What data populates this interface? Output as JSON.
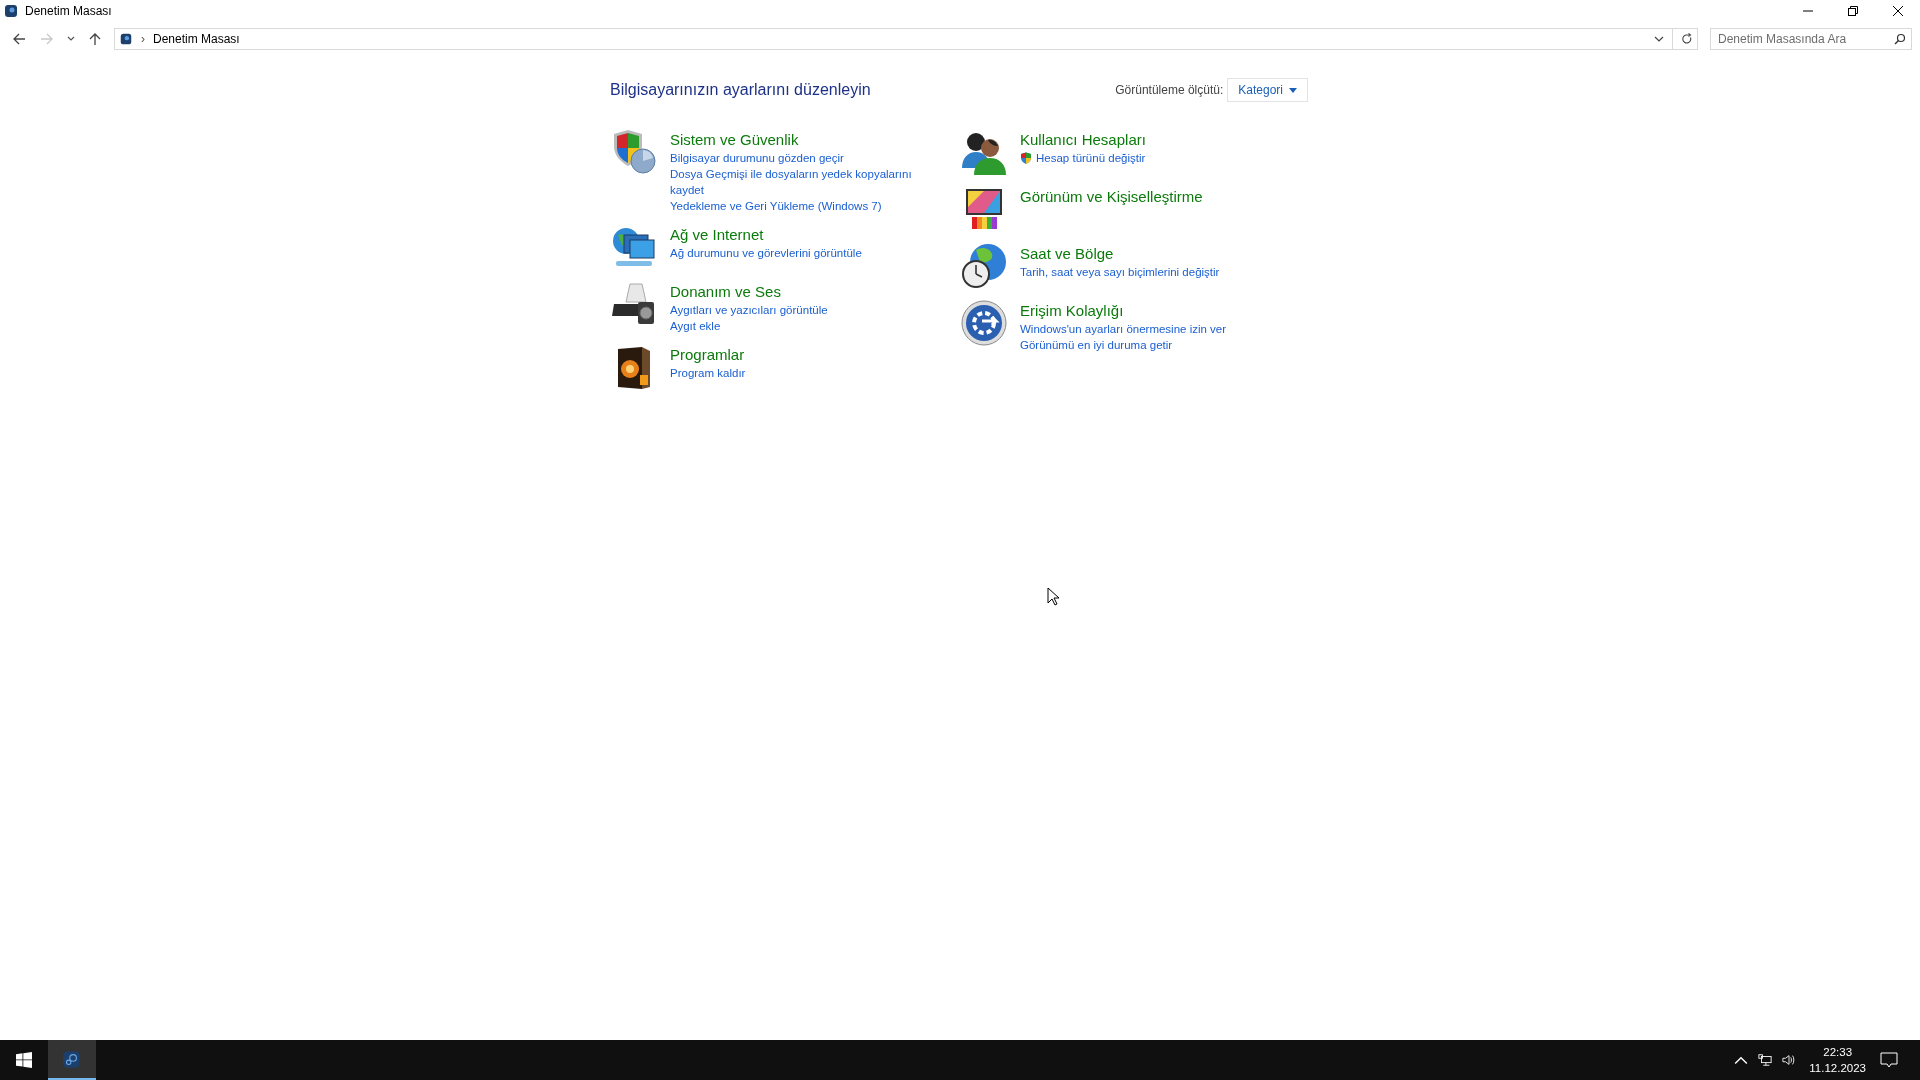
{
  "window": {
    "title": "Denetim Masası"
  },
  "address_bar": {
    "forward_disabled": true,
    "separator": "›",
    "path": "Denetim Masası"
  },
  "search": {
    "placeholder": "Denetim Masasında Ara"
  },
  "heading": "Bilgisayarınızın ayarlarını düzenleyin",
  "view_by": {
    "label": "Görüntüleme ölçütü:",
    "value": "Kategori"
  },
  "columns": [
    {
      "categories": [
        {
          "title": "Sistem ve Güvenlik",
          "links": [
            {
              "text": "Bilgisayar durumunu gözden geçir",
              "shield": false
            },
            {
              "text": "Dosya Geçmişi ile dosyaların yedek kopyalarını kaydet",
              "shield": false
            },
            {
              "text": "Yedekleme ve Geri Yükleme (Windows 7)",
              "shield": false
            }
          ]
        },
        {
          "title": "Ağ ve Internet",
          "links": [
            {
              "text": "Ağ durumunu ve görevlerini görüntüle",
              "shield": false
            }
          ]
        },
        {
          "title": "Donanım ve Ses",
          "links": [
            {
              "text": "Aygıtları ve yazıcıları görüntüle",
              "shield": false
            },
            {
              "text": "Aygıt ekle",
              "shield": false
            }
          ]
        },
        {
          "title": "Programlar",
          "links": [
            {
              "text": "Program kaldır",
              "shield": false
            }
          ]
        }
      ]
    },
    {
      "categories": [
        {
          "title": "Kullanıcı Hesapları",
          "links": [
            {
              "text": "Hesap türünü değiştir",
              "shield": true
            }
          ]
        },
        {
          "title": "Görünüm ve Kişiselleştirme"
        },
        {
          "title": "Saat ve Bölge",
          "links": [
            {
              "text": "Tarih, saat veya sayı biçimlerini değiştir",
              "shield": false
            }
          ]
        },
        {
          "title": "Erişim Kolaylığı",
          "links": [
            {
              "text": "Windows'un ayarları önermesine izin ver",
              "shield": false
            },
            {
              "text": "Görünümü en iyi duruma getir",
              "shield": false
            }
          ]
        }
      ]
    }
  ],
  "taskbar": {
    "apps": [
      {
        "selected": true
      }
    ],
    "time": "22:33",
    "date": "11.12.2023"
  }
}
